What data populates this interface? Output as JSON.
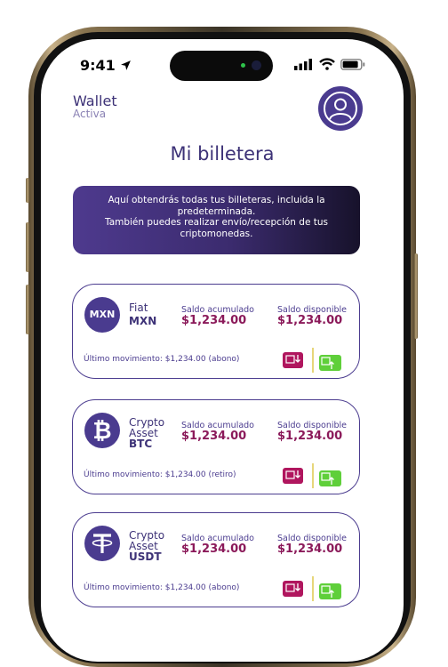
{
  "status_bar": {
    "time": "9:41"
  },
  "header": {
    "wallet_title": "Wallet",
    "wallet_subtitle": "Activa"
  },
  "page": {
    "title": "Mi billetera"
  },
  "banner": {
    "line1": "Aquí obtendrás todas tus billeteras, incluida la predeterminada.",
    "line2": "También puedes realizar envío/recepción de tus criptomonedas."
  },
  "wallets": [
    {
      "icon": "MXN",
      "icon_name": "mxn-badge-icon",
      "type": "Fiat",
      "code": "MXN",
      "saldo_acumulado_label": "Saldo acumulado",
      "saldo_acumulado": "$1,234.00",
      "saldo_disponible_label": "Saldo disponible",
      "saldo_disponible": "$1,234.00",
      "ultimo_movimiento": "Último movimiento: $1,234.00 (abono)"
    },
    {
      "icon": "",
      "icon_name": "bitcoin-icon",
      "type": "Crypto Asset",
      "code": "BTC",
      "saldo_acumulado_label": "Saldo acumulado",
      "saldo_acumulado": "$1,234.00",
      "saldo_disponible_label": "Saldo disponible",
      "saldo_disponible": "$1,234.00",
      "ultimo_movimiento": "Último movimiento: $1,234.00 (retiro)"
    },
    {
      "icon": "",
      "icon_name": "tether-icon",
      "type": "Crypto Asset",
      "code": "USDT",
      "saldo_acumulado_label": "Saldo acumulado",
      "saldo_acumulado": "$1,234.00",
      "saldo_disponible_label": "Saldo disponible",
      "saldo_disponible": "$1,234.00",
      "ultimo_movimiento": "Último movimiento: $1,234.00 (abono)"
    }
  ],
  "colors": {
    "primary": "#4a3b8f",
    "amount": "#8b1a5a",
    "deposit": "#b0165e",
    "withdraw": "#5fcf3a"
  }
}
